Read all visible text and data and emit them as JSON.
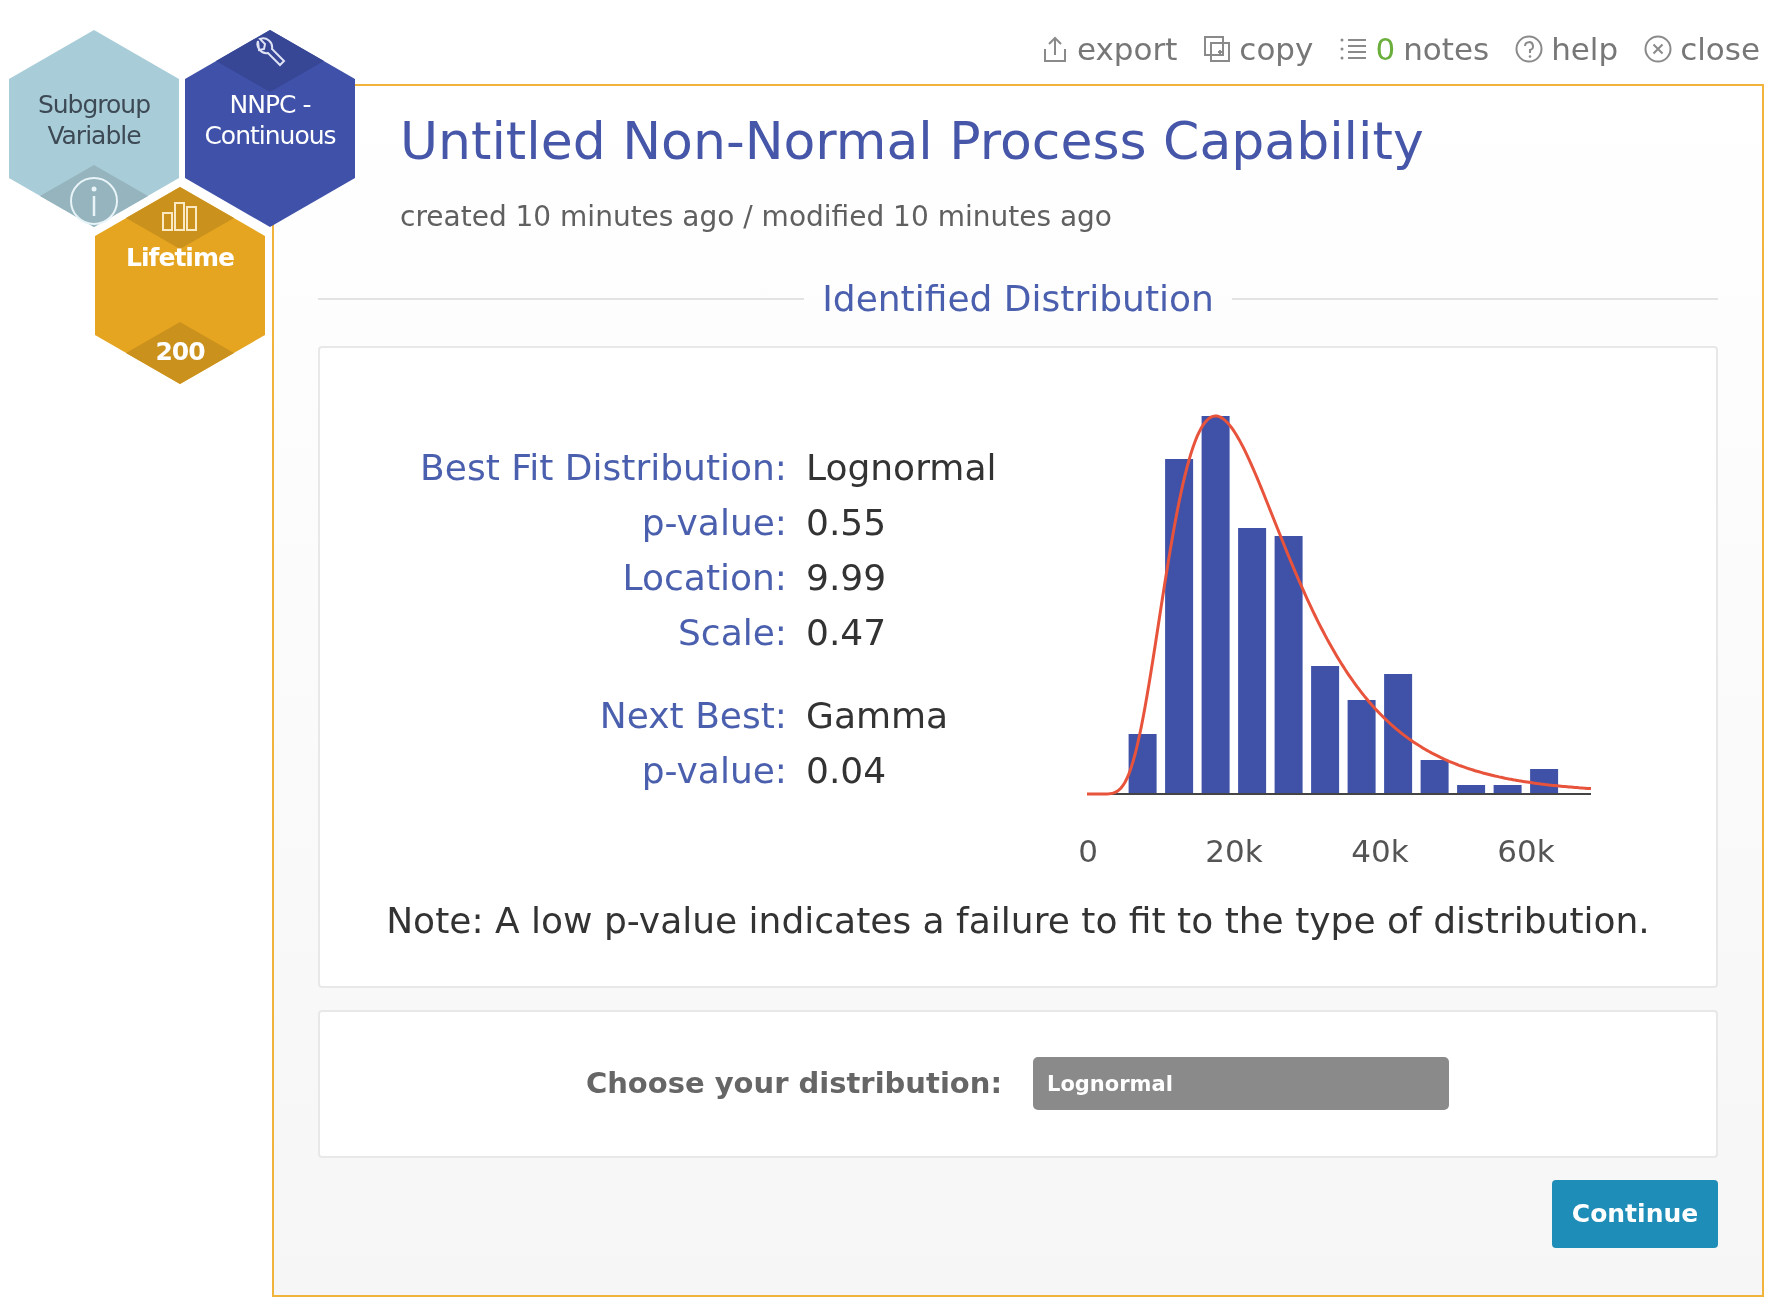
{
  "hexagons": [
    {
      "kind": "variable",
      "label": "Subgroup Variable",
      "color": "#a9cdd8"
    },
    {
      "kind": "tool",
      "label": "NNPC - Continuous",
      "color": "#3f51a9"
    },
    {
      "kind": "data",
      "label": "Lifetime",
      "count": "200",
      "color": "#e6a521"
    }
  ],
  "toolbar": [
    {
      "kind": "export",
      "label": "export"
    },
    {
      "kind": "copy",
      "label": "copy"
    },
    {
      "kind": "notes",
      "count": "0",
      "label": "notes"
    },
    {
      "kind": "help",
      "label": "help"
    },
    {
      "kind": "close",
      "label": "close"
    }
  ],
  "title": "Untitled Non-Normal Process Capability",
  "subtitle": "created 10 minutes ago / modified 10 minutes ago",
  "section_title": "Identified Distribution",
  "best_fit": [
    {
      "label": "Best Fit Distribution:",
      "value": "Lognormal"
    },
    {
      "label": "p-value:",
      "value": "0.55"
    },
    {
      "label": "Location:",
      "value": "9.99"
    },
    {
      "label": "Scale:",
      "value": "0.47"
    }
  ],
  "next_best": [
    {
      "label": "Next Best:",
      "value": "Gamma"
    },
    {
      "label": "p-value:",
      "value": "0.04"
    }
  ],
  "histogram": {
    "x_tick_labels": [
      "0",
      "20k",
      "40k",
      "60k"
    ]
  },
  "note": "Note: A low p-value indicates a failure to fit to the type of distribution.",
  "chooser": {
    "label": "Choose your distribution:",
    "value": "Lognormal"
  },
  "continue_button": "Continue"
}
